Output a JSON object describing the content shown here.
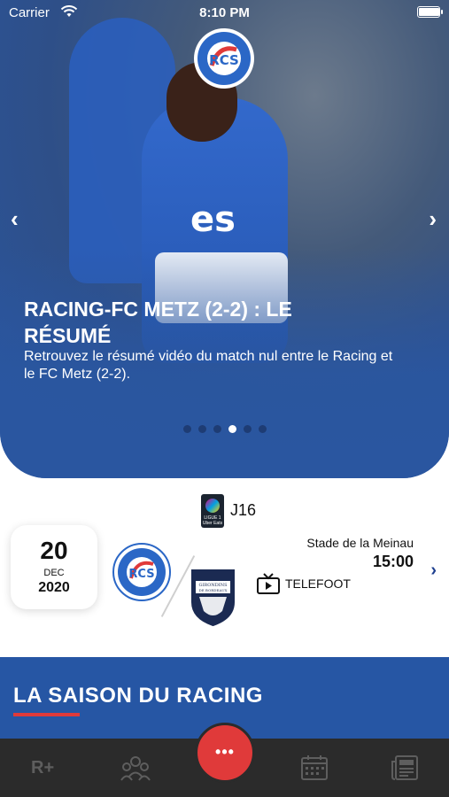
{
  "status_bar": {
    "carrier": "Carrier",
    "time": "8:10 PM",
    "battery_level": 0.95
  },
  "hero": {
    "title": "RACING-FC METZ (2-2) : LE RÉSUMÉ",
    "description": "Retrouvez le résumé vidéo du match nul entre le Racing et le FC Metz (2-2).",
    "jersey_text": "es",
    "prev_label": "‹",
    "next_label": "›",
    "dot_count": 6,
    "active_dot": 3
  },
  "match": {
    "journee": "J16",
    "league_badge_text": "LIGUE 1 Uber Eats",
    "day": "20",
    "month": "DEC",
    "year": "2020",
    "stadium": "Stade de la Meinau",
    "kickoff": "15:00",
    "broadcaster": "TELEFOOT",
    "prev_label": "‹",
    "next_label": "›",
    "away_logo_text": "GIRONDINS DE BORDEAUX"
  },
  "section": {
    "title": "LA SAISON DU RACING"
  },
  "tabbar": {
    "rplus_label": "R+",
    "center_label": "•••",
    "icons": [
      "rplus-icon",
      "squad-icon",
      "more-icon",
      "calendar-icon",
      "news-icon"
    ]
  },
  "colors": {
    "brand_blue": "#2656a4",
    "accent_red": "#e03a3a",
    "tabbar_bg": "#2b2b2b"
  }
}
